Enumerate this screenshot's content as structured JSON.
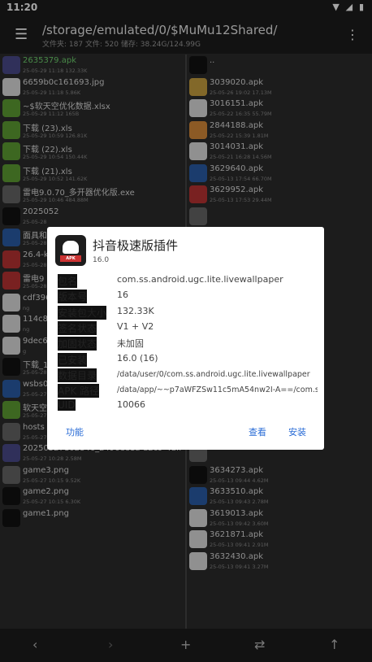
{
  "status": {
    "time": "11:20",
    "icons": "▼ ◢ ▮"
  },
  "appbar": {
    "path": "/storage/emulated/0/$MuMu12Shared/",
    "info": "文件夹: 187  文件: 520  储存: 38.24G/124.99G"
  },
  "left_files": [
    {
      "name": "2635379.apk",
      "meta": "25-05-29 11:18  132.33K",
      "icon": "apk-icon",
      "color": "p",
      "selected": true
    },
    {
      "name": "6659b0c161693.jpg",
      "meta": "25-05-29 11:18  5.86K",
      "icon": "image-icon",
      "color": "w"
    },
    {
      "name": "~$软天空优化数据.xlsx",
      "meta": "25-05-29 11:12  165B",
      "icon": "spreadsheet-icon",
      "color": "g"
    },
    {
      "name": "下载 (23).xls",
      "meta": "25-05-29 10:59  126.81K",
      "icon": "spreadsheet-icon",
      "color": "g"
    },
    {
      "name": "下载 (22).xls",
      "meta": "25-05-29 10:54  150.44K",
      "icon": "spreadsheet-icon",
      "color": "g"
    },
    {
      "name": "下载 (21).xls",
      "meta": "25-05-29 10:52  141.62K",
      "icon": "spreadsheet-icon",
      "color": "g"
    },
    {
      "name": "雷电9.0.70_多开器优化版.exe",
      "meta": "25-05-29 10:46  484.88M",
      "icon": "file-icon",
      "color": "d"
    },
    {
      "name": "2025052",
      "meta": "25-05-28",
      "icon": "image-icon",
      "color": "k"
    },
    {
      "name": "面具和",
      "meta": "25-05-28",
      "icon": "apk-icon",
      "color": "b"
    },
    {
      "name": "26.4-k",
      "meta": "25-05-28",
      "icon": "apk-icon",
      "color": "r"
    },
    {
      "name": "雷电9",
      "meta": "25-05-28",
      "icon": "apk-icon",
      "color": "r"
    },
    {
      "name": "cdf396",
      "meta": "ng",
      "icon": "image-icon",
      "color": "w"
    },
    {
      "name": "114c8",
      "meta": "ng",
      "icon": "image-icon",
      "color": "w"
    },
    {
      "name": "9dec6",
      "meta": "g",
      "icon": "image-icon",
      "color": "w"
    },
    {
      "name": "下载_1",
      "meta": "25-05-28",
      "icon": "image-icon",
      "color": "k"
    },
    {
      "name": "wsbs0410.jpg",
      "meta": "25-05-27 19:41  36.71K",
      "icon": "image-icon",
      "color": "b"
    },
    {
      "name": "软天空优化数据.xlsx",
      "meta": "25-05-27 19:31  16.02M",
      "icon": "spreadsheet-icon",
      "color": "g"
    },
    {
      "name": "hosts",
      "meta": "25-05-27 15:53  1.74K",
      "icon": "file-icon",
      "color": "d"
    },
    {
      "name": "20250527102846_2496ee1a-d2c9-4dff-b80a-88076703e460.json",
      "meta": "25-05-27 10:28  2.58M",
      "icon": "json-icon",
      "color": "p"
    },
    {
      "name": "game3.png",
      "meta": "25-05-27 10:15  9.52K",
      "icon": "image-icon",
      "color": "d"
    },
    {
      "name": "game2.png",
      "meta": "25-05-27 10:15  6.30K",
      "icon": "gamepad-icon",
      "color": "k"
    },
    {
      "name": "game1.png",
      "meta": "",
      "icon": "image-icon",
      "color": "k"
    }
  ],
  "right_files": [
    {
      "name": "..",
      "meta": "",
      "icon": "folder-icon",
      "color": "k"
    },
    {
      "name": "3039020.apk",
      "meta": "25-05-26 19:02  17.13M",
      "icon": "apk-icon",
      "color": "y"
    },
    {
      "name": "3016151.apk",
      "meta": "25-05-22 16:35  55.79M",
      "icon": "apk-icon",
      "color": "w"
    },
    {
      "name": "2844188.apk",
      "meta": "25-05-22 15:39  1.81M",
      "icon": "apk-icon",
      "color": "o"
    },
    {
      "name": "3014031.apk",
      "meta": "25-05-21 16:28  14.56M",
      "icon": "apk-icon",
      "color": "w"
    },
    {
      "name": "3629640.apk",
      "meta": "25-05-13 17:54  66.70M",
      "icon": "apk-icon",
      "color": "b"
    },
    {
      "name": "3629952.apk",
      "meta": "25-05-13 17:53  29.44M",
      "icon": "apk-icon",
      "color": "r"
    },
    {
      "name": "",
      "meta": "",
      "icon": "apk-icon",
      "color": "d"
    },
    {
      "name": "",
      "meta": "",
      "icon": "apk-icon",
      "color": "d"
    },
    {
      "name": "",
      "meta": "",
      "icon": "apk-icon",
      "color": "d"
    },
    {
      "name": "",
      "meta": "",
      "icon": "apk-icon",
      "color": "d"
    },
    {
      "name": "",
      "meta": "",
      "icon": "apk-icon",
      "color": "d"
    },
    {
      "name": "",
      "meta": "",
      "icon": "apk-icon",
      "color": "d"
    },
    {
      "name": "",
      "meta": "",
      "icon": "apk-icon",
      "color": "d"
    },
    {
      "name": "",
      "meta": "",
      "icon": "apk-icon",
      "color": "d"
    },
    {
      "name": "",
      "meta": "",
      "icon": "apk-icon",
      "color": "d"
    },
    {
      "name": "",
      "meta": "",
      "icon": "apk-icon",
      "color": "d"
    },
    {
      "name": "",
      "meta": "",
      "icon": "apk-icon",
      "color": "d"
    },
    {
      "name": "",
      "meta": "",
      "icon": "apk-icon",
      "color": "d"
    },
    {
      "name": "3634273.apk",
      "meta": "25-05-13 09:44  4.62M",
      "icon": "apk-icon",
      "color": "k"
    },
    {
      "name": "3633510.apk",
      "meta": "25-05-13 09:43  2.78M",
      "icon": "apk-icon",
      "color": "b"
    },
    {
      "name": "3619013.apk",
      "meta": "25-05-13 09:42  3.60M",
      "icon": "apk-icon",
      "color": "w"
    },
    {
      "name": "3621871.apk",
      "meta": "25-05-13 09:41  2.91M",
      "icon": "apk-icon",
      "color": "w"
    },
    {
      "name": "3632430.apk",
      "meta": "25-05-13 09:41  3.27M",
      "icon": "apk-icon",
      "color": "w"
    }
  ],
  "dialog": {
    "icon_tag": "APK",
    "title": "抖音极速版插件",
    "version_short": "16.0",
    "rows": [
      {
        "key": "包名",
        "value": "com.ss.android.ugc.lite.livewallpaper",
        "small": false
      },
      {
        "key": "版本号",
        "value": "16",
        "small": false
      },
      {
        "key": "安装包大小",
        "value": "132.33K",
        "small": false
      },
      {
        "key": "签名状态",
        "value": "V1 + V2",
        "small": false
      },
      {
        "key": "加固状态",
        "value": "未加固",
        "small": false
      },
      {
        "key": "已安装",
        "value": "16.0 (16)",
        "small": false
      },
      {
        "key": "数据目录",
        "value": "/data/user/0/com.ss.android.ugc.lite.livewallpaper",
        "small": true
      },
      {
        "key": "APK 路径",
        "value": "/data/app/~~p7aWFZSw11c5mA54nw2I-A==/com.s...",
        "small": true
      },
      {
        "key": "UID",
        "value": "10066",
        "small": false
      }
    ],
    "btn_function": "功能",
    "btn_view": "查看",
    "btn_install": "安装",
    "accent": "#2a6cd6"
  },
  "bottombar": {
    "back": "‹",
    "forward": "›",
    "add": "+",
    "swap": "⇄",
    "up": "↑"
  }
}
